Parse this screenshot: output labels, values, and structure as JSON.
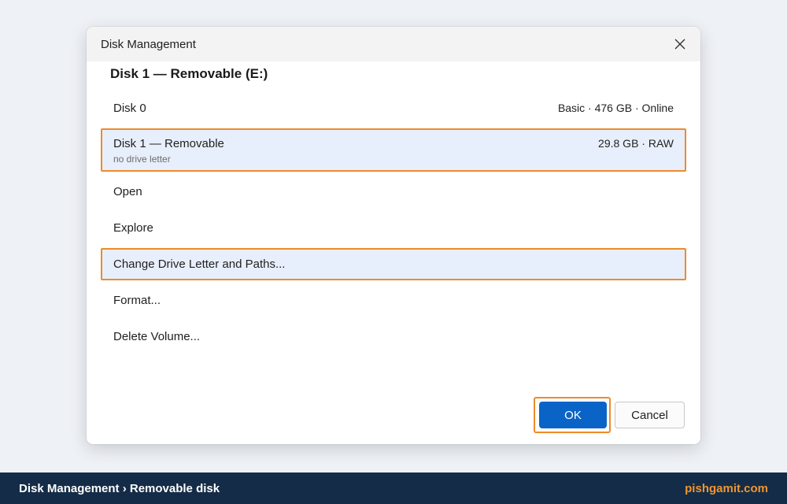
{
  "dialog": {
    "title": "Disk Management",
    "heading": "Disk 1 — Removable (E:)",
    "close_icon": "close-icon",
    "items": [
      {
        "label": "Disk 0",
        "meta": "Basic · 476 GB · Online"
      },
      {
        "label": "Disk 1 — Removable",
        "sublabel": "no drive letter",
        "meta": "29.8 GB · RAW"
      },
      {
        "label": "Open"
      },
      {
        "label": "Explore"
      },
      {
        "label": "Change Drive Letter and Paths..."
      },
      {
        "label": "Format..."
      },
      {
        "label": "Delete Volume..."
      }
    ],
    "ok_label": "OK",
    "cancel_label": "Cancel"
  },
  "footer": {
    "breadcrumb": "Disk Management › Removable disk",
    "brand": "pishgamit.com"
  },
  "colors": {
    "accent": "#0a64c8",
    "highlight_border": "#ee8a2a",
    "selected_bg": "#e8effc",
    "footer_bg": "#142c47",
    "brand": "#f0952f"
  }
}
